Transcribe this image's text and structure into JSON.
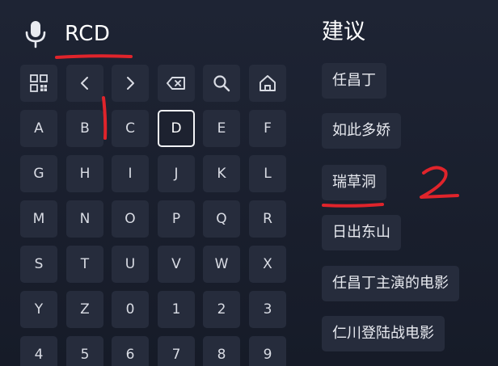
{
  "search": {
    "mic_icon": "microphone-icon",
    "query": "RCD"
  },
  "keyboard": {
    "selected_key": "D",
    "function_keys": [
      {
        "name": "qr-code-key",
        "icon": "qr-code-icon"
      },
      {
        "name": "cursor-left-key",
        "icon": "chevron-left-icon"
      },
      {
        "name": "cursor-right-key",
        "icon": "chevron-right-icon"
      },
      {
        "name": "backspace-key",
        "icon": "backspace-icon"
      },
      {
        "name": "search-key",
        "icon": "search-icon"
      },
      {
        "name": "home-key",
        "icon": "home-icon"
      }
    ],
    "rows": [
      [
        "A",
        "B",
        "C",
        "D",
        "E",
        "F"
      ],
      [
        "G",
        "H",
        "I",
        "J",
        "K",
        "L"
      ],
      [
        "M",
        "N",
        "O",
        "P",
        "Q",
        "R"
      ],
      [
        "S",
        "T",
        "U",
        "V",
        "W",
        "X"
      ],
      [
        "Y",
        "Z",
        "0",
        "1",
        "2",
        "3"
      ],
      [
        "4",
        "5",
        "6",
        "7",
        "8",
        "9"
      ]
    ]
  },
  "suggestions": {
    "title": "建议",
    "items": [
      "任昌丁",
      "如此多娇",
      "瑞草洞",
      "日出东山",
      "任昌丁主演的电影",
      "仁川登陆战电影"
    ]
  },
  "annotations": {
    "marks": [
      "1",
      "2"
    ],
    "color": "#e0242b"
  },
  "colors": {
    "background": "#1b2030",
    "key_bg": "#262c3c",
    "selected_border": "#f2f3f6"
  }
}
